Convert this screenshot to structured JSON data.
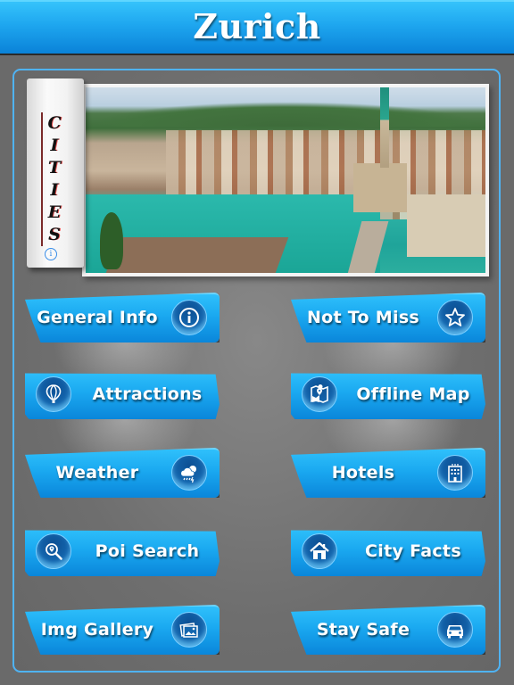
{
  "header": {
    "title": "Zurich"
  },
  "banner": {
    "scroll_label": "CITIES",
    "info_icon": "info-icon",
    "photo_description": "Aerial view of Zurich old town with river, boats and church spire"
  },
  "menu": {
    "buttons": [
      {
        "id": "general-info",
        "label": "General Info",
        "icon": "info-icon",
        "icon_side": "right"
      },
      {
        "id": "not-to-miss",
        "label": "Not To Miss",
        "icon": "star-icon",
        "icon_side": "right"
      },
      {
        "id": "attractions",
        "label": "Attractions",
        "icon": "hot-air-balloon-icon",
        "icon_side": "left"
      },
      {
        "id": "offline-map",
        "label": "Offline Map",
        "icon": "map-pin-icon",
        "icon_side": "left"
      },
      {
        "id": "weather",
        "label": "Weather",
        "icon": "weather-cloud-sun-rain-icon",
        "icon_side": "right"
      },
      {
        "id": "hotels",
        "label": "Hotels",
        "icon": "hotel-building-icon",
        "icon_side": "right"
      },
      {
        "id": "poi-search",
        "label": "Poi Search",
        "icon": "location-search-icon",
        "icon_side": "left"
      },
      {
        "id": "city-facts",
        "label": "City Facts",
        "icon": "home-icon",
        "icon_side": "left"
      },
      {
        "id": "img-gallery",
        "label": "Img Gallery",
        "icon": "photo-gallery-icon",
        "icon_side": "right"
      },
      {
        "id": "stay-safe",
        "label": "Stay Safe",
        "icon": "car-icon",
        "icon_side": "right"
      }
    ]
  },
  "colors": {
    "header_top": "#35c3fb",
    "header_bottom": "#0a82d8",
    "button_blue": "#1aa8f0",
    "icon_circle": "#1466ae",
    "panel_border": "#4fb3f4",
    "background": "#6a6a6a"
  }
}
